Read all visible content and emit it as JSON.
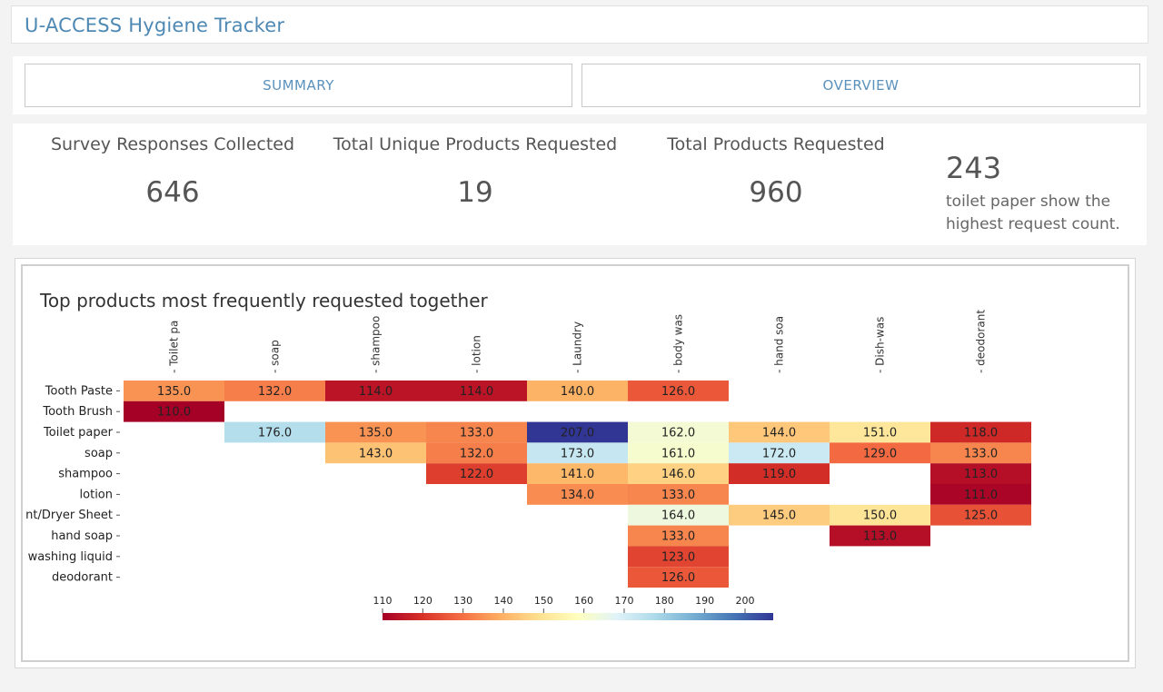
{
  "header": {
    "title": "U-ACCESS Hygiene Tracker"
  },
  "nav": {
    "summary_label": "SUMMARY",
    "overview_label": "OVERVIEW"
  },
  "kpis": [
    {
      "label": "Survey Responses Collected",
      "value": "646"
    },
    {
      "label": "Total Unique Products Requested",
      "value": "19"
    },
    {
      "label": "Total Products Requested",
      "value": "960"
    }
  ],
  "highlight": {
    "value": "243",
    "line1": "toilet paper show the",
    "line2": "highest request count."
  },
  "colors": {
    "title": "#4e89b4",
    "nav_text": "#5b91bb"
  },
  "chart_data": {
    "type": "heatmap",
    "title": "Top products most frequently requested together",
    "columns": [
      "Toilet pa",
      "soap",
      "shampoo",
      "lotion",
      "Laundry",
      "body was",
      "hand soa",
      "Dish-was",
      "deodorant"
    ],
    "rows": [
      "Tooth Paste",
      "Tooth Brush",
      "Toilet paper",
      "soap",
      "shampoo",
      "lotion",
      "nt/Dryer Sheet",
      "hand soap",
      "washing liquid",
      "deodorant"
    ],
    "values": [
      [
        135.0,
        132.0,
        114.0,
        114.0,
        140.0,
        126.0,
        null,
        null,
        null
      ],
      [
        110.0,
        null,
        null,
        null,
        null,
        null,
        null,
        null,
        null
      ],
      [
        null,
        176.0,
        135.0,
        133.0,
        207.0,
        162.0,
        144.0,
        151.0,
        118.0
      ],
      [
        null,
        null,
        143.0,
        132.0,
        173.0,
        161.0,
        172.0,
        129.0,
        133.0
      ],
      [
        null,
        null,
        null,
        122.0,
        141.0,
        146.0,
        119.0,
        null,
        113.0
      ],
      [
        null,
        null,
        null,
        null,
        134.0,
        133.0,
        null,
        null,
        111.0
      ],
      [
        null,
        null,
        null,
        null,
        null,
        164.0,
        145.0,
        150.0,
        125.0
      ],
      [
        null,
        null,
        null,
        null,
        null,
        133.0,
        null,
        113.0,
        null
      ],
      [
        null,
        null,
        null,
        null,
        null,
        123.0,
        null,
        null,
        null
      ],
      [
        null,
        null,
        null,
        null,
        null,
        126.0,
        null,
        null,
        null
      ]
    ],
    "colorbar_ticks": [
      110,
      120,
      130,
      140,
      150,
      160,
      170,
      180,
      190,
      200
    ],
    "color_range": [
      110,
      207
    ],
    "colormap": "RdYlBu"
  }
}
